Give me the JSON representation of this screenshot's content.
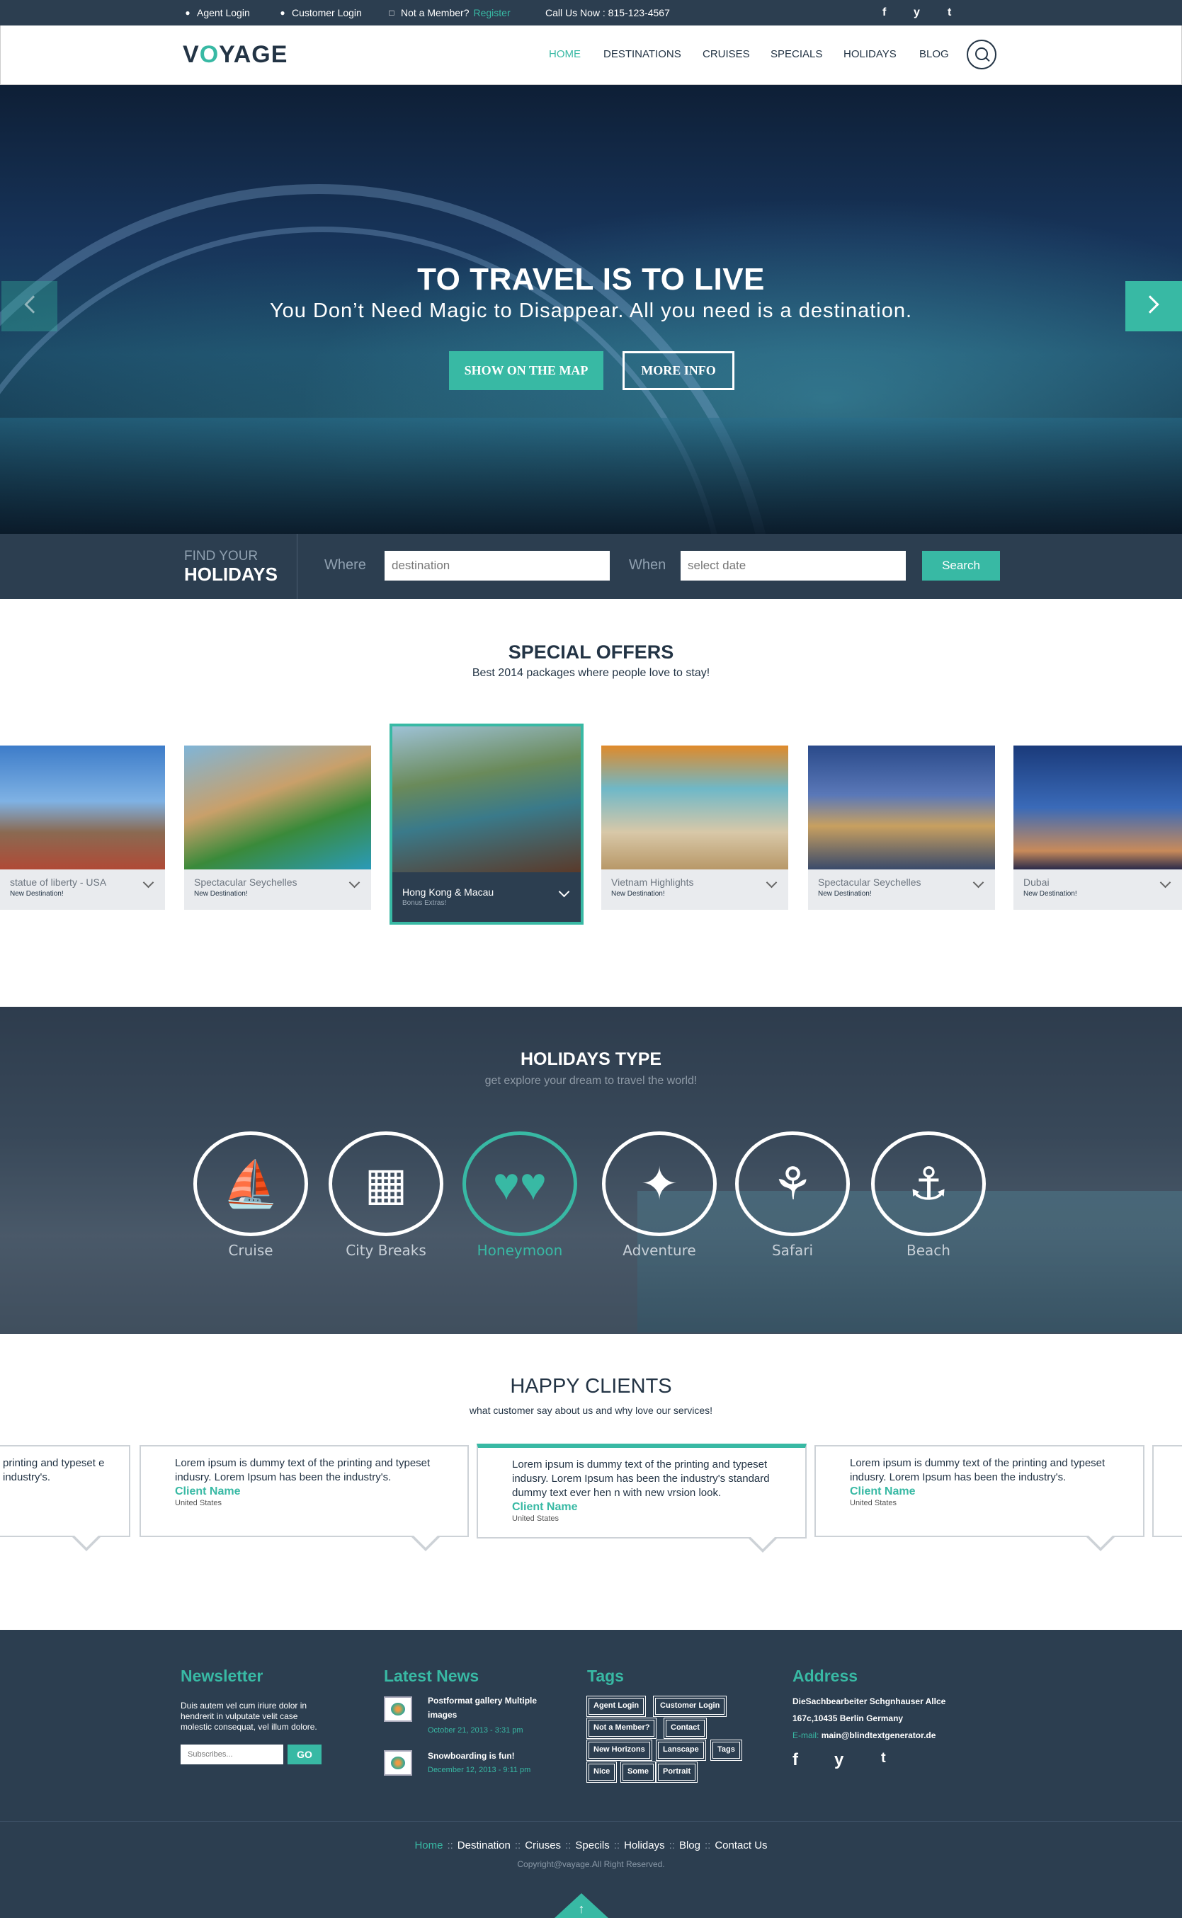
{
  "topbar": {
    "agent_login": "Agent Login",
    "customer_login": "Customer Login",
    "not_member": "Not a Member?",
    "register": "Register",
    "call_us": "Call Us Now : 815-123-4567",
    "social": [
      "f",
      "y",
      "t"
    ]
  },
  "header": {
    "logo_prefix": "V",
    "logo_o": "O",
    "logo_suffix": "YAGE",
    "nav": [
      "HOME",
      "DESTINATIONS",
      "CRUISES",
      "SPECIALS",
      "HOLIDAYS",
      "BLOG"
    ],
    "active_nav": "HOME"
  },
  "hero": {
    "title": "TO TRAVEL IS TO LIVE",
    "subtitle": "You Don’t Need Magic to Disappear. All you need is a destination.",
    "btn_map": "SHOW ON THE MAP",
    "btn_more": "MORE INFO"
  },
  "find": {
    "small": "FIND YOUR",
    "big": "HOLIDAYS",
    "where_label": "Where",
    "where_value": "destination",
    "when_label": "When",
    "when_value": "select date",
    "search": "Search"
  },
  "special_offers": {
    "title": "SPECIAL OFFERS",
    "subtitle": "Best 2014 packages where people love to stay!",
    "items": [
      {
        "name": "statue of liberty - USA",
        "tag": "New Destination!"
      },
      {
        "name": "Spectacular Seychelles",
        "tag": "New Destination!"
      },
      {
        "name": "Hong Kong & Macau",
        "tag": "Bonus Extras!"
      },
      {
        "name": "Vietnam Highlights",
        "tag": "New Destination!"
      },
      {
        "name": "Spectacular Seychelles",
        "tag": "New Destination!"
      },
      {
        "name": "Dubai",
        "tag": "New Destination!"
      }
    ]
  },
  "holidays_type": {
    "title": "HOLIDAYS TYPE",
    "subtitle": "get explore your dream to travel the world!",
    "items": [
      {
        "label": "Cruise",
        "icon": "ship-icon"
      },
      {
        "label": "City Breaks",
        "icon": "buildings-icon"
      },
      {
        "label": "Honeymoon",
        "icon": "hearts-icon"
      },
      {
        "label": "Adventure",
        "icon": "compass-icon"
      },
      {
        "label": "Safari",
        "icon": "palm-trees-icon"
      },
      {
        "label": "Beach",
        "icon": "speedboat-icon"
      }
    ]
  },
  "happy_clients": {
    "title": "HAPPY CLIENTS",
    "subtitle": "what customer say about us and why love our services!",
    "cards": [
      {
        "text": "printing and typeset e industry's."
      },
      {
        "text": "Lorem ipsum is dummy text of the printing and typeset indusry. Lorem Ipsum has been the industry's.",
        "name": "Client Name",
        "country": "United States"
      },
      {
        "text": "Lorem ipsum is dummy text of the printing and typeset indusry. Lorem Ipsum has been the industry's standard dummy text ever hen n with new vrsion look.",
        "name": "Client Name",
        "country": "United States"
      },
      {
        "text": "Lorem ipsum is dummy text of the printing and typeset indusry. Lorem Ipsum has been the industry's.",
        "name": "Client Name",
        "country": "United States"
      }
    ]
  },
  "footer": {
    "newsletter": {
      "title": "Newsletter",
      "text": "Duis autem vel cum iriure dolor in hendrerit in vulputate velit case molestic consequat, vel illum dolore.",
      "placeholder": "Subscribes...",
      "go": "GO"
    },
    "news": {
      "title": "Latest News",
      "items": [
        {
          "title": "Postformat gallery Multiple images",
          "date": "October 21, 2013 - 3:31 pm"
        },
        {
          "title": "Snowboarding is fun!",
          "date": "December 12, 2013 - 9:11 pm"
        }
      ]
    },
    "tags": {
      "title": "Tags",
      "items": [
        "Agent Login",
        "Customer Login",
        "Not a Member?",
        "Contact",
        "New Horizons",
        "Lanscape",
        "Tags",
        "Nice",
        "Some",
        "Portrait"
      ]
    },
    "address": {
      "title": "Address",
      "line1": "DieSachbearbeiter Schgnhauser Allce",
      "line2": "167c,10435 Berlin Germany",
      "email_label": "E-mail:",
      "email": "main@blindtextgenerator.de",
      "social": [
        "f",
        "y",
        "t"
      ]
    },
    "links": [
      "Home",
      "Destination",
      "Criuses",
      "Specils",
      "Holidays",
      "Blog",
      "Contact Us"
    ],
    "links_sep": "::",
    "copyright": "Copyright@vayage.All Right Reserved."
  }
}
